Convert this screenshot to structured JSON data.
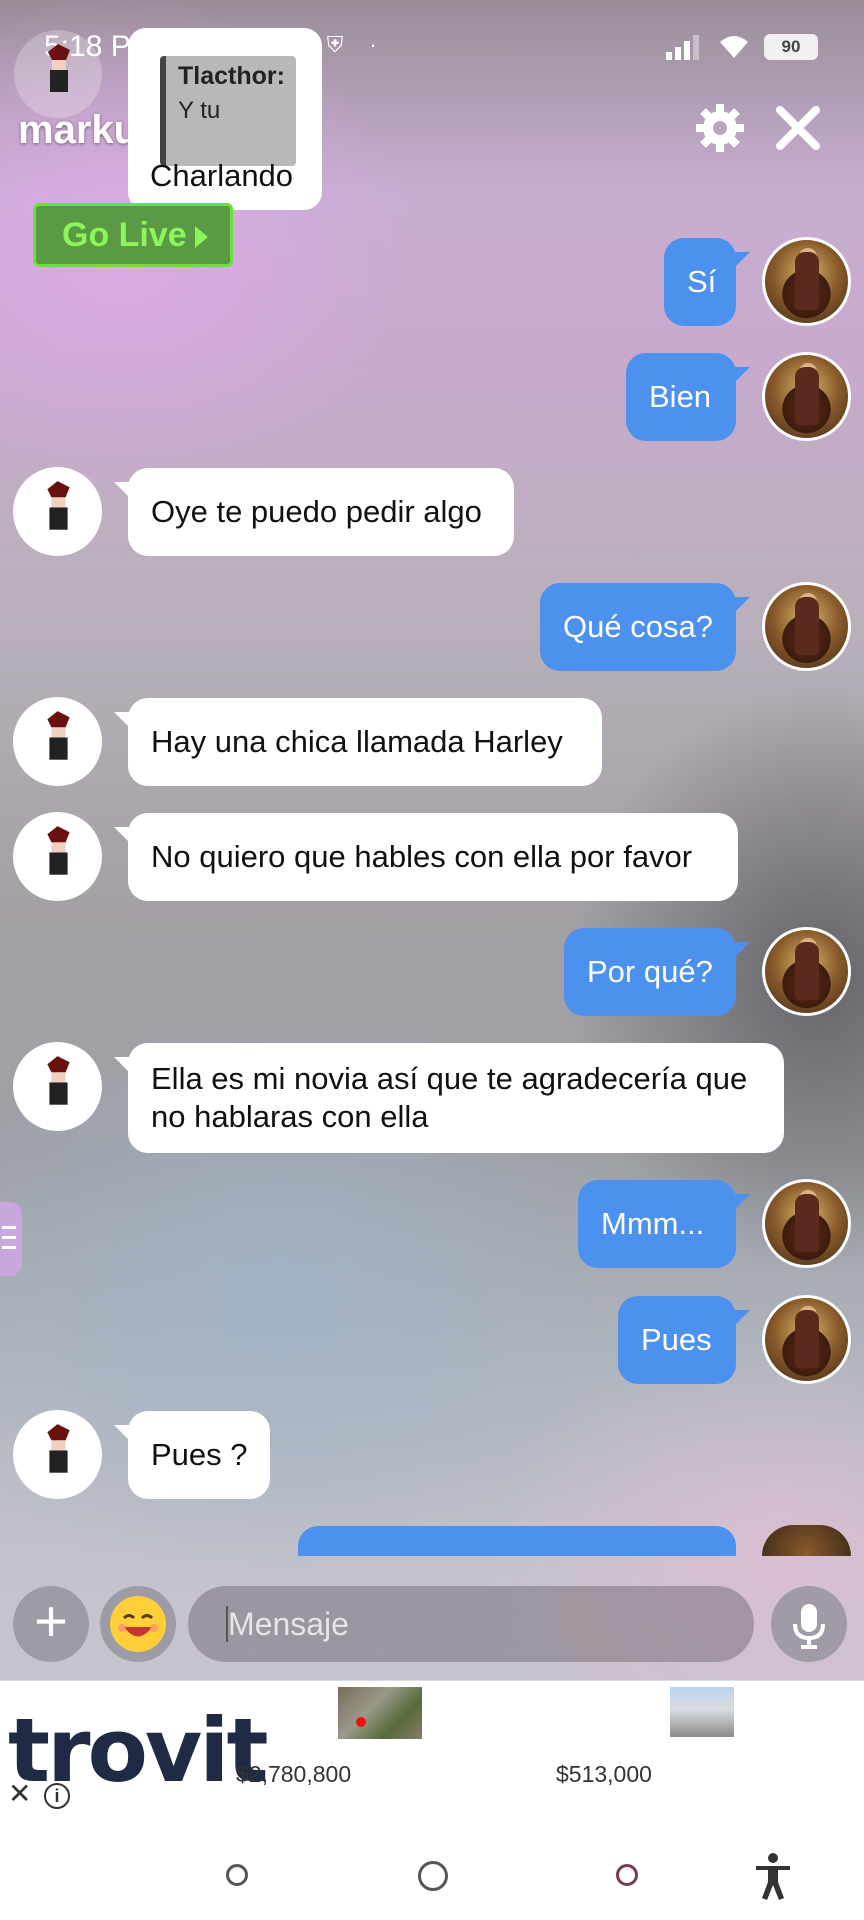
{
  "status_bar": {
    "time": "5:18 PM",
    "battery": "90"
  },
  "header": {
    "name": "markus"
  },
  "reply_preview": {
    "quote_author": "Tlacthor:",
    "quote_text": "Y tu",
    "text": "Charlando"
  },
  "go_live": {
    "label": "Go Live"
  },
  "messages": [
    {
      "side": "out",
      "text": "Sí"
    },
    {
      "side": "out",
      "text": "Bien"
    },
    {
      "side": "in",
      "text": "Oye te puedo pedir algo"
    },
    {
      "side": "out",
      "text": "Qué cosa?"
    },
    {
      "side": "in",
      "text": "Hay una chica llamada Harley"
    },
    {
      "side": "in",
      "text": "No quiero que hables con ella por favor"
    },
    {
      "side": "out",
      "text": "Por qué?"
    },
    {
      "side": "in",
      "text": "Ella es mi novia así que te agradecería que no hablaras con ella"
    },
    {
      "side": "out",
      "text": "Mmm..."
    },
    {
      "side": "out",
      "text": "Pues"
    },
    {
      "side": "in",
      "text": "Pues ?"
    }
  ],
  "composer": {
    "placeholder": "Mensaje"
  },
  "ad": {
    "brand": "trovit",
    "listings": [
      {
        "price": "$2,780,800"
      },
      {
        "price": "$513,000"
      }
    ]
  },
  "colors": {
    "outgoing_bubble": "#4c91ee",
    "incoming_bubble": "#ffffff",
    "go_live": "#5b9a45"
  }
}
